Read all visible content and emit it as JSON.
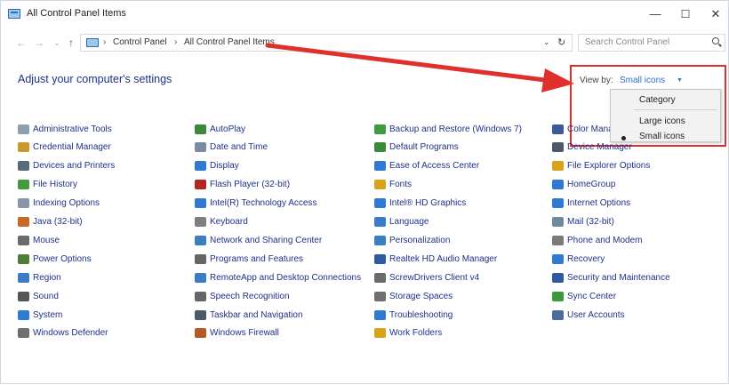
{
  "window": {
    "title": "All Control Panel Items",
    "buttons": {
      "minimize": "—",
      "maximize": "☐",
      "close": "✕"
    }
  },
  "address": {
    "back": "←",
    "forward": "→",
    "recent": "⌄",
    "up": "↑",
    "sep": "›",
    "crumbs": [
      "Control Panel",
      "All Control Panel Items"
    ],
    "dropdown": "⌄",
    "refresh": "↻"
  },
  "search": {
    "placeholder": "Search Control Panel"
  },
  "heading": "Adjust your computer's settings",
  "viewby": {
    "label": "View by:",
    "value": "Small icons",
    "caret": "▼",
    "options": [
      "Category",
      "Large icons",
      "Small icons"
    ],
    "selected": "Small icons"
  },
  "items": [
    [
      {
        "label": "Administrative Tools",
        "icon": "admin-tools",
        "color": "#8ca0b0"
      },
      {
        "label": "Credential Manager",
        "icon": "credential",
        "color": "#c79a2f"
      },
      {
        "label": "Devices and Printers",
        "icon": "printer",
        "color": "#5a6a78"
      },
      {
        "label": "File History",
        "icon": "file-history",
        "color": "#3f9b3f"
      },
      {
        "label": "Indexing Options",
        "icon": "indexing",
        "color": "#8a96a6"
      },
      {
        "label": "Java (32-bit)",
        "icon": "java",
        "color": "#c56b2a"
      },
      {
        "label": "Mouse",
        "icon": "mouse",
        "color": "#6b6b6b"
      },
      {
        "label": "Power Options",
        "icon": "power",
        "color": "#4e7d3a"
      },
      {
        "label": "Region",
        "icon": "region",
        "color": "#3b7cc7"
      },
      {
        "label": "Sound",
        "icon": "sound",
        "color": "#555555"
      },
      {
        "label": "System",
        "icon": "system",
        "color": "#2f7bd1"
      },
      {
        "label": "Windows Defender",
        "icon": "defender",
        "color": "#6f6f6f"
      }
    ],
    [
      {
        "label": "AutoPlay",
        "icon": "autoplay",
        "color": "#3a8a3a"
      },
      {
        "label": "Date and Time",
        "icon": "clock",
        "color": "#7a8ca0"
      },
      {
        "label": "Display",
        "icon": "display",
        "color": "#2f7bd1"
      },
      {
        "label": "Flash Player (32-bit)",
        "icon": "flash",
        "color": "#b3261e"
      },
      {
        "label": "Intel(R) Technology Access",
        "icon": "intel-tech",
        "color": "#2f7bd1"
      },
      {
        "label": "Keyboard",
        "icon": "keyboard",
        "color": "#7f7f7f"
      },
      {
        "label": "Network and Sharing Center",
        "icon": "network",
        "color": "#3a7fc1"
      },
      {
        "label": "Programs and Features",
        "icon": "programs",
        "color": "#666666"
      },
      {
        "label": "RemoteApp and Desktop Connections",
        "icon": "remoteapp",
        "color": "#3b7cc7"
      },
      {
        "label": "Speech Recognition",
        "icon": "microphone",
        "color": "#666666"
      },
      {
        "label": "Taskbar and Navigation",
        "icon": "taskbar",
        "color": "#4a5a6a"
      },
      {
        "label": "Windows Firewall",
        "icon": "firewall",
        "color": "#b35a2a"
      }
    ],
    [
      {
        "label": "Backup and Restore (Windows 7)",
        "icon": "backup",
        "color": "#3f9b3f"
      },
      {
        "label": "Default Programs",
        "icon": "default-programs",
        "color": "#3a8a3a"
      },
      {
        "label": "Ease of Access Center",
        "icon": "ease-access",
        "color": "#2f7bd1"
      },
      {
        "label": "Fonts",
        "icon": "fonts",
        "color": "#d9a21b"
      },
      {
        "label": "Intel® HD Graphics",
        "icon": "intel-graphics",
        "color": "#2f7bd1"
      },
      {
        "label": "Language",
        "icon": "language",
        "color": "#3b7cc7"
      },
      {
        "label": "Personalization",
        "icon": "personalization",
        "color": "#3a7fc1"
      },
      {
        "label": "Realtek HD Audio Manager",
        "icon": "realtek",
        "color": "#2f5aa0"
      },
      {
        "label": "ScrewDrivers Client v4",
        "icon": "screwdrivers",
        "color": "#6b6b6b"
      },
      {
        "label": "Storage Spaces",
        "icon": "storage",
        "color": "#6f6f6f"
      },
      {
        "label": "Troubleshooting",
        "icon": "troubleshoot",
        "color": "#2f7bd1"
      },
      {
        "label": "Work Folders",
        "icon": "work-folders",
        "color": "#d9a21b"
      }
    ],
    [
      {
        "label": "Color Management",
        "icon": "color-mgmt",
        "color": "#3a5a9a"
      },
      {
        "label": "Device Manager",
        "icon": "device-manager",
        "color": "#4a5a6a"
      },
      {
        "label": "File Explorer Options",
        "icon": "folder-options",
        "color": "#d9a21b"
      },
      {
        "label": "HomeGroup",
        "icon": "homegroup",
        "color": "#2f7bd1"
      },
      {
        "label": "Internet Options",
        "icon": "internet",
        "color": "#2f7bd1"
      },
      {
        "label": "Mail (32-bit)",
        "icon": "mail",
        "color": "#6f8a9f"
      },
      {
        "label": "Phone and Modem",
        "icon": "phone",
        "color": "#7a7a7a"
      },
      {
        "label": "Recovery",
        "icon": "recovery",
        "color": "#2f7bd1"
      },
      {
        "label": "Security and Maintenance",
        "icon": "flag",
        "color": "#2f5aa0"
      },
      {
        "label": "Sync Center",
        "icon": "sync",
        "color": "#3a9a3a"
      },
      {
        "label": "User Accounts",
        "icon": "users",
        "color": "#4a6aa0"
      }
    ]
  ]
}
